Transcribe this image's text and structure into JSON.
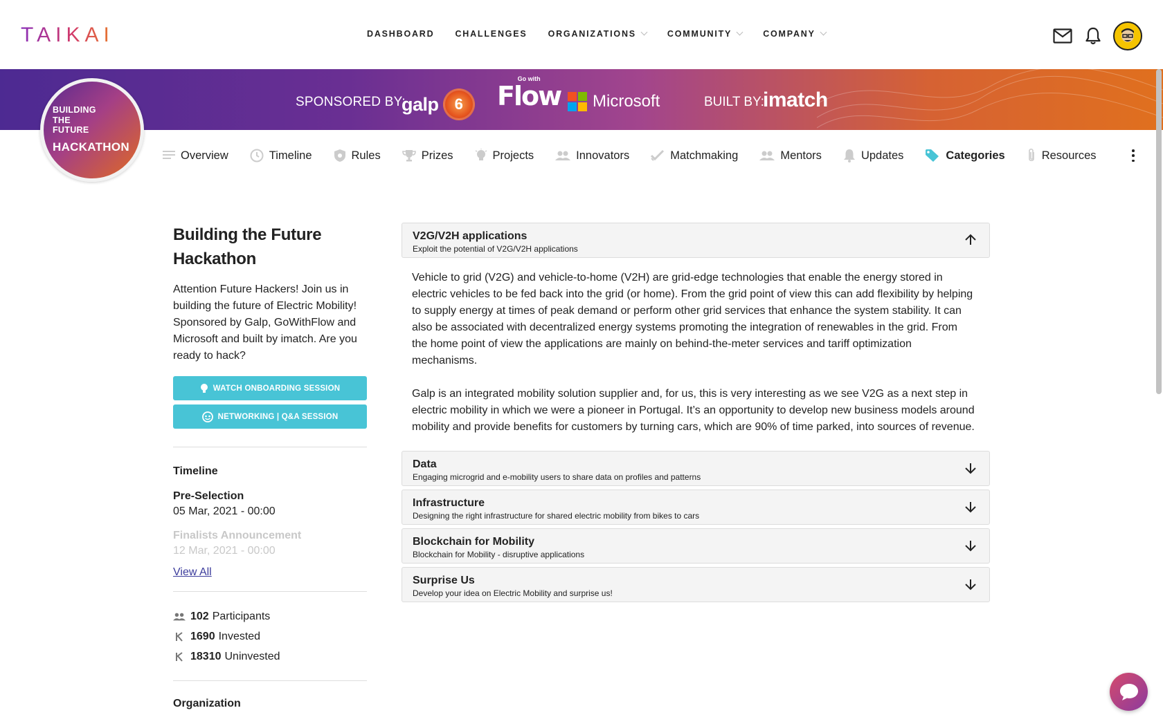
{
  "brand": {
    "logo": "TAIKAI"
  },
  "nav": {
    "items": [
      {
        "label": "DASHBOARD",
        "dropdown": false
      },
      {
        "label": "CHALLENGES",
        "dropdown": false
      },
      {
        "label": "ORGANIZATIONS",
        "dropdown": true
      },
      {
        "label": "COMMUNITY",
        "dropdown": true
      },
      {
        "label": "COMPANY",
        "dropdown": true
      }
    ]
  },
  "top_icons": [
    "mail-icon",
    "bell-icon",
    "user-avatar"
  ],
  "banner": {
    "sponsored_label": "SPONSORED BY:",
    "sponsors": [
      "galp",
      "Microsoft"
    ],
    "flow_small": "Go with",
    "flow_word": "Flow",
    "built_label": "BUILT BY:",
    "builder": "imatch",
    "badge_top": "BUILDING THE FUTURE",
    "badge_bottom": "HACKATHON"
  },
  "tabs": [
    {
      "label": "Overview",
      "icon": "list-icon",
      "active": false
    },
    {
      "label": "Timeline",
      "icon": "clock-icon",
      "active": false
    },
    {
      "label": "Rules",
      "icon": "shield-icon",
      "active": false
    },
    {
      "label": "Prizes",
      "icon": "trophy-icon",
      "active": false
    },
    {
      "label": "Projects",
      "icon": "lightbulb-icon",
      "active": false
    },
    {
      "label": "Innovators",
      "icon": "people-icon",
      "active": false
    },
    {
      "label": "Matchmaking",
      "icon": "check-icon",
      "active": false
    },
    {
      "label": "Mentors",
      "icon": "people-icon",
      "active": false
    },
    {
      "label": "Updates",
      "icon": "bell-icon",
      "active": false
    },
    {
      "label": "Categories",
      "icon": "tag-icon",
      "active": true
    },
    {
      "label": "Resources",
      "icon": "paperclip-icon",
      "active": false
    }
  ],
  "challenge": {
    "title": "Building the Future Hackathon",
    "description": "Attention Future Hackers! Join us in building the future of Electric Mobility! Sponsored by Galp, GoWithFlow and Microsoft and built by imatch. Are you ready to hack?",
    "buttons": {
      "onboarding": "WATCH ONBOARDING SESSION",
      "networking": "NETWORKING | Q&A SESSION"
    },
    "timeline": {
      "heading": "Timeline",
      "items": [
        {
          "name": "Pre-Selection",
          "date": "05 Mar, 2021 - 00:00"
        },
        {
          "name": "Finalists Announcement",
          "date": "12 Mar, 2021 - 00:00"
        }
      ],
      "view_all": "View All"
    },
    "stats": [
      {
        "value": "102",
        "label": "Participants",
        "icon": "people-icon"
      },
      {
        "value": "1690",
        "label": "Invested",
        "icon": "kudos-icon"
      },
      {
        "value": "18310",
        "label": "Uninvested",
        "icon": "kudos-icon"
      }
    ],
    "organization_heading": "Organization"
  },
  "categories": [
    {
      "title": "V2G/V2H applications",
      "subtitle": "Exploit the potential of V2G/V2H applications",
      "expanded": true,
      "body": [
        "Vehicle to grid (V2G) and vehicle-to-home (V2H) are grid-edge technologies that enable the energy stored in electric vehicles to be fed back into the grid (or home). From the grid point of view this can add flexibility by helping to supply energy at times of peak demand or perform other grid services that enhance the system stability. It can also be associated with decentralized energy systems promoting the integration of renewables in the grid. From the home point of view the applications are mainly on behind-the-meter services and tariff optimization mechanisms.",
        "Galp is an integrated mobility solution supplier and, for us, this is very interesting  as we see V2G as a next step in electric mobility in which we were a pioneer in Portugal. It’s an opportunity to develop new business models around mobility and provide benefits for customers by turning cars, which are 90% of time parked, into sources of revenue."
      ]
    },
    {
      "title": "Data",
      "subtitle": "Engaging microgrid and e-mobility users to share data on profiles and patterns",
      "expanded": false
    },
    {
      "title": "Infrastructure",
      "subtitle": "Designing the right infrastructure for shared electric mobility from bikes to cars",
      "expanded": false
    },
    {
      "title": "Blockchain for Mobility",
      "subtitle": "Blockchain for Mobility - disruptive applications",
      "expanded": false
    },
    {
      "title": "Surprise Us",
      "subtitle": "Develop your idea on Electric Mobility and surprise us!",
      "expanded": false
    }
  ],
  "colors": {
    "accent": "#48c4d6",
    "active_tab_icon": "#48c4d6",
    "link": "#3c3c9c"
  }
}
